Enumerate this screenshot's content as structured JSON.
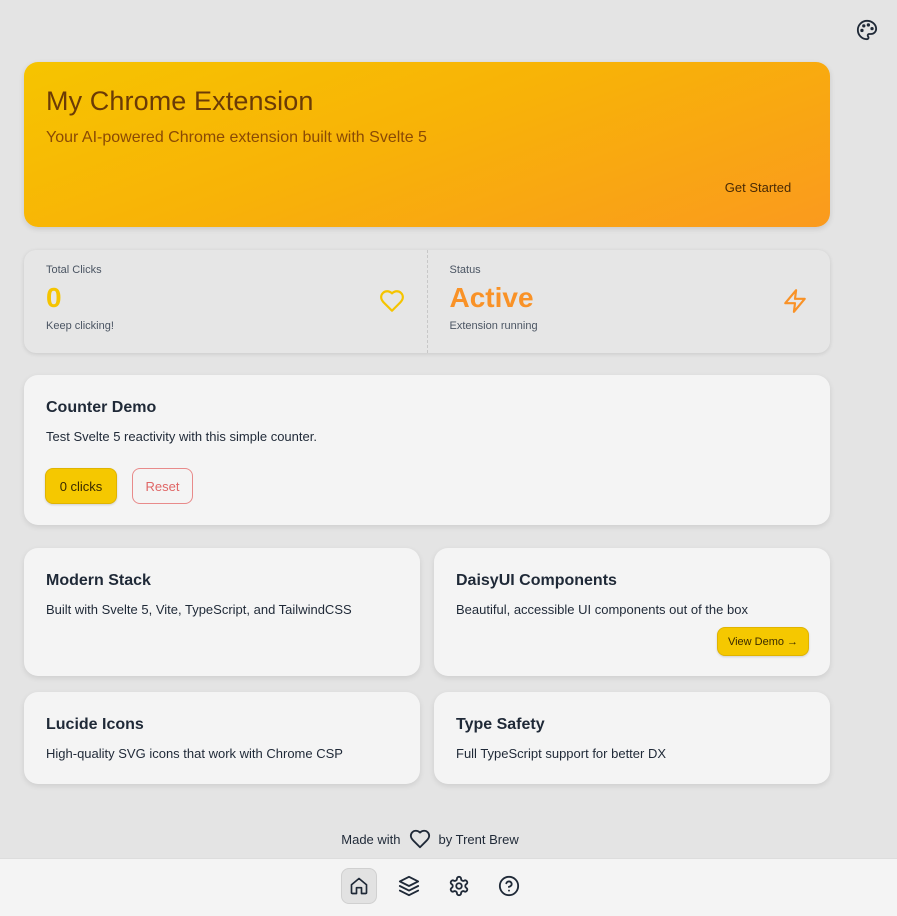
{
  "theme": {
    "icon": "palette-icon"
  },
  "hero": {
    "title": "My Chrome Extension",
    "subtitle": "Your AI-powered Chrome extension built with Svelte 5",
    "cta_label": "Get Started"
  },
  "stats": [
    {
      "label": "Total Clicks",
      "value": "0",
      "sub": "Keep clicking!",
      "icon": "heart-icon",
      "color": "#f5c400"
    },
    {
      "label": "Status",
      "value": "Active",
      "sub": "Extension running",
      "icon": "zap-icon",
      "color": "#f99227"
    }
  ],
  "counter": {
    "title": "Counter Demo",
    "description": "Test Svelte 5 reactivity with this simple counter.",
    "clicks_label": "0 clicks",
    "reset_label": "Reset"
  },
  "features": [
    {
      "title": "Modern Stack",
      "description": "Built with Svelte 5, Vite, TypeScript, and TailwindCSS"
    },
    {
      "title": "DaisyUI Components",
      "description": "Beautiful, accessible UI components out of the box",
      "button": "View Demo →"
    },
    {
      "title": "Lucide Icons",
      "description": "High-quality SVG icons that work with Chrome CSP"
    },
    {
      "title": "Type Safety",
      "description": "Full TypeScript support for better DX"
    }
  ],
  "footer": {
    "prefix": "Made with",
    "suffix": "by Trent Brew",
    "icon": "heart-icon"
  },
  "nav": [
    {
      "icon": "home-icon",
      "active": true
    },
    {
      "icon": "layers-icon",
      "active": false
    },
    {
      "icon": "settings-icon",
      "active": false
    },
    {
      "icon": "help-circle-icon",
      "active": false
    }
  ],
  "colors": {
    "accent": "#f5c400",
    "orange": "#f99227",
    "danger": "#e06666"
  }
}
